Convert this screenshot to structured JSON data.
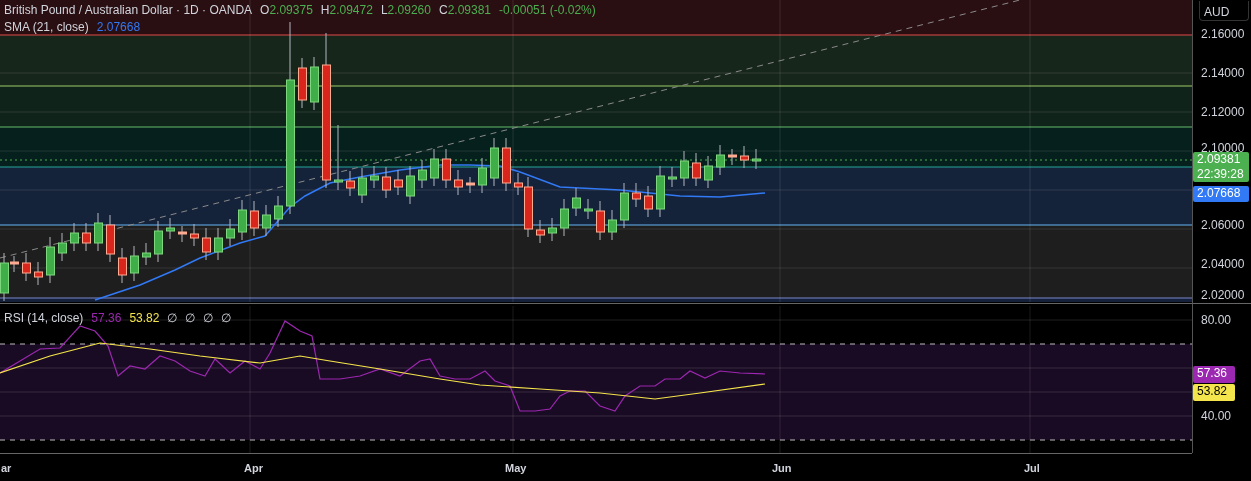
{
  "legend": {
    "symbol": "British Pound / Australian Dollar · 1D · OANDA",
    "ohlc": [
      {
        "label": "O",
        "value": "2.09375"
      },
      {
        "label": "H",
        "value": "2.09472"
      },
      {
        "label": "L",
        "value": "2.09260"
      },
      {
        "label": "C",
        "value": "2.09381"
      }
    ],
    "change": "-0.00051 (-0.02%)"
  },
  "indicators": [
    {
      "name": "SMA (21, close)",
      "value": "2.07668",
      "color": "#3179f5"
    }
  ],
  "price_axis": {
    "currency": "AUD",
    "ticks": [
      "2.16000",
      "2.14000",
      "2.12000",
      "2.10000"
    ],
    "lower_ticks": [
      "2.06000",
      "2.04000",
      "2.02000"
    ],
    "last_price": "2.09381",
    "countdown": "22:39:28",
    "sma_label": "2.07668"
  },
  "rsi": {
    "name": "RSI (14, close)",
    "values": [
      {
        "text": "57.36",
        "color": "#9c27b0"
      },
      {
        "text": "53.82",
        "color": "#f5e54c"
      }
    ],
    "empty_values": [
      "∅",
      "∅",
      "∅",
      "∅"
    ],
    "ticks": [
      "80.00",
      "40.00"
    ],
    "axis_labels": [
      {
        "text": "57.36",
        "color": "#9c27b0"
      },
      {
        "text": "53.82",
        "color": "#f5e54c"
      }
    ]
  },
  "time_axis": [
    "ar",
    "Apr",
    "May",
    "Jun",
    "Jul"
  ]
}
